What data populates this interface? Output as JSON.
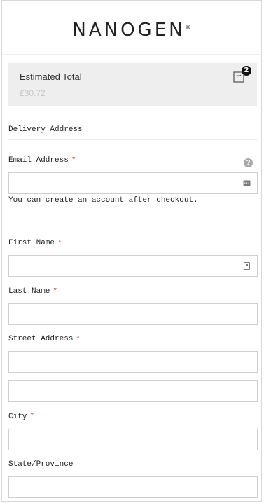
{
  "header": {
    "logo_text": "NANOGEN",
    "logo_mark": "®"
  },
  "summary": {
    "label": "Estimated Total",
    "total": "£30.72",
    "cart_count": "2",
    "cart_icon": "shopping-bag-icon"
  },
  "form": {
    "section_title": "Delivery Address",
    "required_mark": "*",
    "email": {
      "label": "Email Address",
      "value": "",
      "placeholder": "",
      "note": "You can create an account after checkout.",
      "help_icon": "?"
    },
    "first_name": {
      "label": "First Name",
      "value": "",
      "placeholder": ""
    },
    "last_name": {
      "label": "Last Name",
      "value": "",
      "placeholder": ""
    },
    "street": {
      "label": "Street Address",
      "line1": "",
      "line2": ""
    },
    "city": {
      "label": "City",
      "value": ""
    },
    "state": {
      "label": "State/Province",
      "value": ""
    }
  },
  "colors": {
    "required": "#d43b3b",
    "summary_bg": "#eeeeee",
    "muted_total": "#c7c7c7"
  }
}
